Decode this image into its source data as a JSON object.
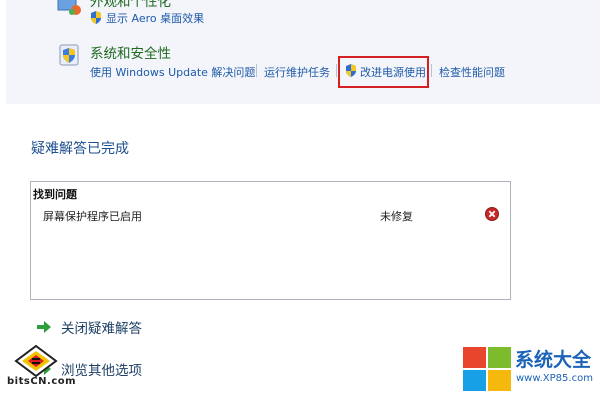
{
  "control_panel": {
    "appearance": {
      "title": "外观和个性化",
      "links": [
        "显示 Aero 桌面效果"
      ]
    },
    "system_security": {
      "title": "系统和安全性",
      "links": [
        "使用 Windows Update 解决问题",
        "运行维护任务",
        "改进电源使用",
        "检查性能问题"
      ]
    }
  },
  "troubleshoot": {
    "title": "疑难解答已完成",
    "results_header": "找到问题",
    "problems": [
      {
        "name": "屏幕保护程序已启用",
        "status": "未修复"
      }
    ]
  },
  "actions": {
    "close": "关闭疑难解答",
    "browse": "浏览其他选项"
  },
  "watermarks": {
    "left_text": "bitsCN.com",
    "right_title": "系统大全",
    "right_url": "www.XP85.com"
  },
  "colors": {
    "link": "#1e5aa8",
    "category_title": "#1f6a1f",
    "highlight": "#d42020",
    "error": "#c62828"
  }
}
